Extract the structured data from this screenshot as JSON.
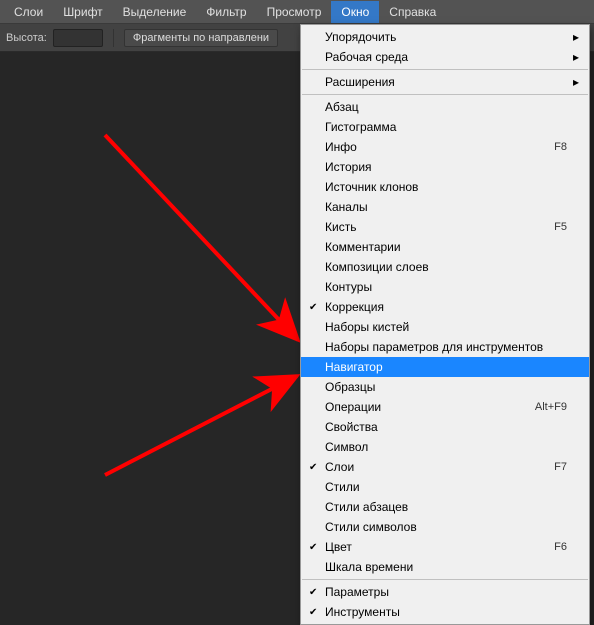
{
  "menubar": {
    "items": [
      {
        "label": "Слои",
        "active": false
      },
      {
        "label": "Шрифт",
        "active": false
      },
      {
        "label": "Выделение",
        "active": false
      },
      {
        "label": "Фильтр",
        "active": false
      },
      {
        "label": "Просмотр",
        "active": false
      },
      {
        "label": "Окно",
        "active": true
      },
      {
        "label": "Справка",
        "active": false
      }
    ]
  },
  "toolbar": {
    "height_label": "Высота:",
    "fragments_label": "Фрагменты по направлени"
  },
  "dropdown": {
    "groups": [
      [
        {
          "label": "Упорядочить",
          "submenu": true
        },
        {
          "label": "Рабочая среда",
          "submenu": true
        }
      ],
      [
        {
          "label": "Расширения",
          "submenu": true
        }
      ],
      [
        {
          "label": "Абзац"
        },
        {
          "label": "Гистограмма"
        },
        {
          "label": "Инфо",
          "shortcut": "F8"
        },
        {
          "label": "История"
        },
        {
          "label": "Источник клонов"
        },
        {
          "label": "Каналы"
        },
        {
          "label": "Кисть",
          "shortcut": "F5"
        },
        {
          "label": "Комментарии"
        },
        {
          "label": "Композиции слоев"
        },
        {
          "label": "Контуры"
        },
        {
          "label": "Коррекция",
          "checked": true
        },
        {
          "label": "Наборы кистей"
        },
        {
          "label": "Наборы параметров для инструментов"
        },
        {
          "label": "Навигатор",
          "highlighted": true
        },
        {
          "label": "Образцы"
        },
        {
          "label": "Операции",
          "shortcut": "Alt+F9"
        },
        {
          "label": "Свойства"
        },
        {
          "label": "Символ"
        },
        {
          "label": "Слои",
          "shortcut": "F7",
          "checked": true
        },
        {
          "label": "Стили"
        },
        {
          "label": "Стили абзацев"
        },
        {
          "label": "Стили символов"
        },
        {
          "label": "Цвет",
          "shortcut": "F6",
          "checked": true
        },
        {
          "label": "Шкала времени"
        }
      ],
      [
        {
          "label": "Параметры",
          "checked": true
        },
        {
          "label": "Инструменты",
          "checked": true
        }
      ]
    ]
  },
  "icons": {
    "submenu": "▸",
    "check": "✔"
  }
}
